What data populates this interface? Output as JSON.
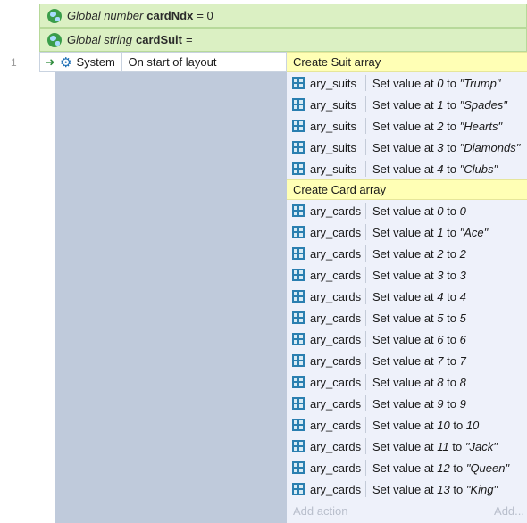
{
  "globals": [
    {
      "prefix": "Global number",
      "name": "cardNdx",
      "rest": "= 0"
    },
    {
      "prefix": "Global string",
      "name": "cardSuit",
      "rest": "="
    }
  ],
  "event": {
    "line_number": "1",
    "condition": {
      "object": "System",
      "text": "On start of layout"
    }
  },
  "groups": [
    {
      "comment": "Create Suit array",
      "actions": [
        {
          "object": "ary_suits",
          "pre": "Set value at ",
          "index": "0",
          "mid": " to ",
          "value": "\"Trump\""
        },
        {
          "object": "ary_suits",
          "pre": "Set value at ",
          "index": "1",
          "mid": " to ",
          "value": "\"Spades\""
        },
        {
          "object": "ary_suits",
          "pre": "Set value at ",
          "index": "2",
          "mid": " to ",
          "value": "\"Hearts\""
        },
        {
          "object": "ary_suits",
          "pre": "Set value at ",
          "index": "3",
          "mid": " to ",
          "value": "\"Diamonds\""
        },
        {
          "object": "ary_suits",
          "pre": "Set value at ",
          "index": "4",
          "mid": " to ",
          "value": "\"Clubs\""
        }
      ]
    },
    {
      "comment": "Create Card array",
      "actions": [
        {
          "object": "ary_cards",
          "pre": "Set value at ",
          "index": "0",
          "mid": " to ",
          "value": "0"
        },
        {
          "object": "ary_cards",
          "pre": "Set value at ",
          "index": "1",
          "mid": " to ",
          "value": "\"Ace\""
        },
        {
          "object": "ary_cards",
          "pre": "Set value at ",
          "index": "2",
          "mid": " to ",
          "value": "2"
        },
        {
          "object": "ary_cards",
          "pre": "Set value at ",
          "index": "3",
          "mid": " to ",
          "value": "3"
        },
        {
          "object": "ary_cards",
          "pre": "Set value at ",
          "index": "4",
          "mid": " to ",
          "value": "4"
        },
        {
          "object": "ary_cards",
          "pre": "Set value at ",
          "index": "5",
          "mid": " to ",
          "value": "5"
        },
        {
          "object": "ary_cards",
          "pre": "Set value at ",
          "index": "6",
          "mid": " to ",
          "value": "6"
        },
        {
          "object": "ary_cards",
          "pre": "Set value at ",
          "index": "7",
          "mid": " to ",
          "value": "7"
        },
        {
          "object": "ary_cards",
          "pre": "Set value at ",
          "index": "8",
          "mid": " to ",
          "value": "8"
        },
        {
          "object": "ary_cards",
          "pre": "Set value at ",
          "index": "9",
          "mid": " to ",
          "value": "9"
        },
        {
          "object": "ary_cards",
          "pre": "Set value at ",
          "index": "10",
          "mid": " to ",
          "value": "10"
        },
        {
          "object": "ary_cards",
          "pre": "Set value at ",
          "index": "11",
          "mid": " to ",
          "value": "\"Jack\""
        },
        {
          "object": "ary_cards",
          "pre": "Set value at ",
          "index": "12",
          "mid": " to ",
          "value": "\"Queen\""
        },
        {
          "object": "ary_cards",
          "pre": "Set value at ",
          "index": "13",
          "mid": " to ",
          "value": "\"King\""
        }
      ]
    }
  ],
  "add_action_label": "Add action",
  "add_more_label": "Add...",
  "icons": {
    "global": "globe-icon",
    "trigger": "trigger-arrow-icon",
    "system": "gear-icon",
    "array": "array-grid-icon"
  }
}
